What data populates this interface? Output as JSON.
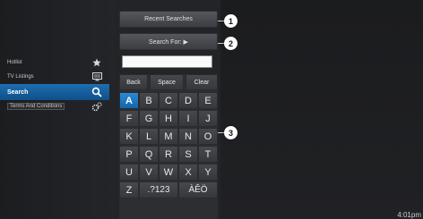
{
  "sidebar": {
    "items": [
      {
        "label": "Hotlist",
        "icon": "star-icon"
      },
      {
        "label": "TV Listings",
        "icon": "tv-guide-icon"
      },
      {
        "label": "Search",
        "icon": "search-icon"
      },
      {
        "label": "Terms And Conditions",
        "icon": "gears-icon"
      }
    ]
  },
  "buttons": {
    "recent_searches": "Recent Searches",
    "search_for": "Search For: ▶"
  },
  "search": {
    "value": ""
  },
  "keyboard": {
    "function_keys": [
      "Back",
      "Space",
      "Clear"
    ],
    "rows": [
      [
        "A",
        "B",
        "C",
        "D",
        "E"
      ],
      [
        "F",
        "G",
        "H",
        "I",
        "J"
      ],
      [
        "K",
        "L",
        "M",
        "N",
        "O"
      ],
      [
        "P",
        "Q",
        "R",
        "S",
        "T"
      ],
      [
        "U",
        "V",
        "W",
        "X",
        "Y"
      ],
      [
        "Z",
        ".?123",
        "ÀÊÖ"
      ]
    ],
    "selected_key": "A"
  },
  "callouts": [
    "1",
    "2",
    "3"
  ],
  "clock": "4:01pm",
  "colors": {
    "selection": "#1e6fb0",
    "background": "#1a1b1d"
  }
}
